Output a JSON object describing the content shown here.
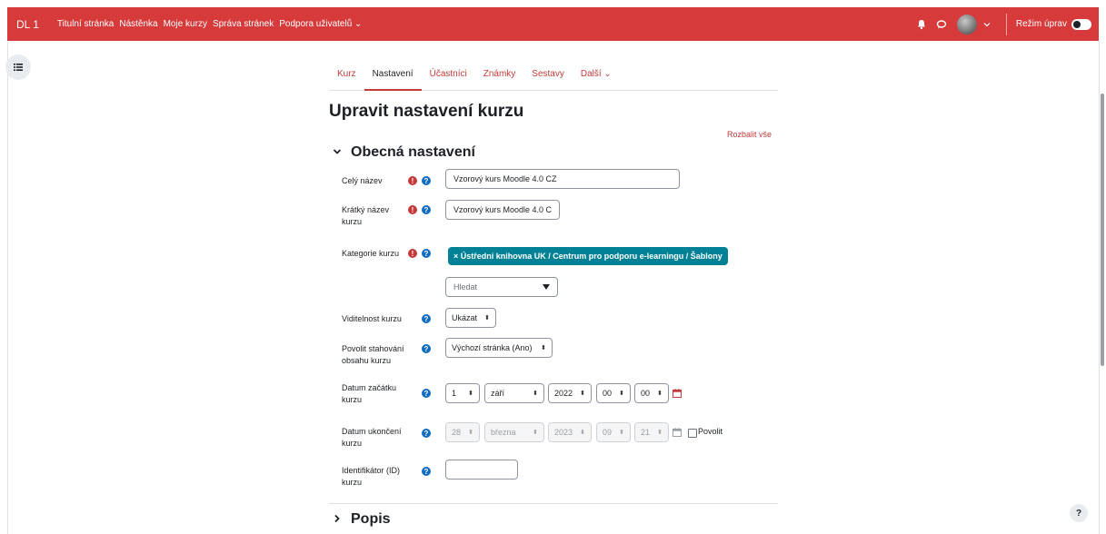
{
  "navbar": {
    "brand": "DL 1",
    "links": [
      "Titulní stránka",
      "Nástěnka",
      "Moje kurzy",
      "Správa stránek",
      "Podpora uživatelů ⌄"
    ],
    "edit_mode_label": "Režim úprav"
  },
  "secondary_nav": {
    "tabs": [
      "Kurz",
      "Nastavení",
      "Účastníci",
      "Známky",
      "Sestavy",
      "Další ⌄"
    ],
    "active": "Nastavení"
  },
  "page": {
    "title": "Upravit nastavení kurzu",
    "expand_all": "Rozbalit vše",
    "section_general": "Obecná nastavení",
    "section_description": "Popis"
  },
  "form": {
    "fullname": {
      "label": "Celý název",
      "value": "Vzorový kurs Moodle 4.0 CZ"
    },
    "shortname": {
      "label_1": "Krátký název",
      "label_2": "kurzu",
      "value": "Vzorový kurs Moodle 4.0 C"
    },
    "category": {
      "label": "Kategorie kurzu",
      "selected": "× Ústřední knihovna UK / Centrum pro podporu e-learningu / Šablony",
      "search_placeholder": "Hledat"
    },
    "visibility": {
      "label": "Viditelnost kurzu",
      "value": "Ukázat"
    },
    "download": {
      "label_1": "Povolit stahování",
      "label_2": "obsahu kurzu",
      "value": "Výchozí stránka (Ano)"
    },
    "startdate": {
      "label_1": "Datum začátku",
      "label_2": "kurzu",
      "day": "1",
      "month": "září",
      "year": "2022",
      "hour": "00",
      "minute": "00"
    },
    "enddate": {
      "label_1": "Datum ukončení",
      "label_2": "kurzu",
      "day": "28",
      "month": "března",
      "year": "2023",
      "hour": "09",
      "minute": "21",
      "enable_label": "Povolit",
      "enabled": false
    },
    "idnumber": {
      "label_1": "Identifikátor (ID)",
      "label_2": "kurzu",
      "value": ""
    }
  },
  "colors": {
    "brand": "#d63a3a",
    "link": "#c43a3a",
    "help": "#0f6cbf",
    "chip": "#008196"
  }
}
